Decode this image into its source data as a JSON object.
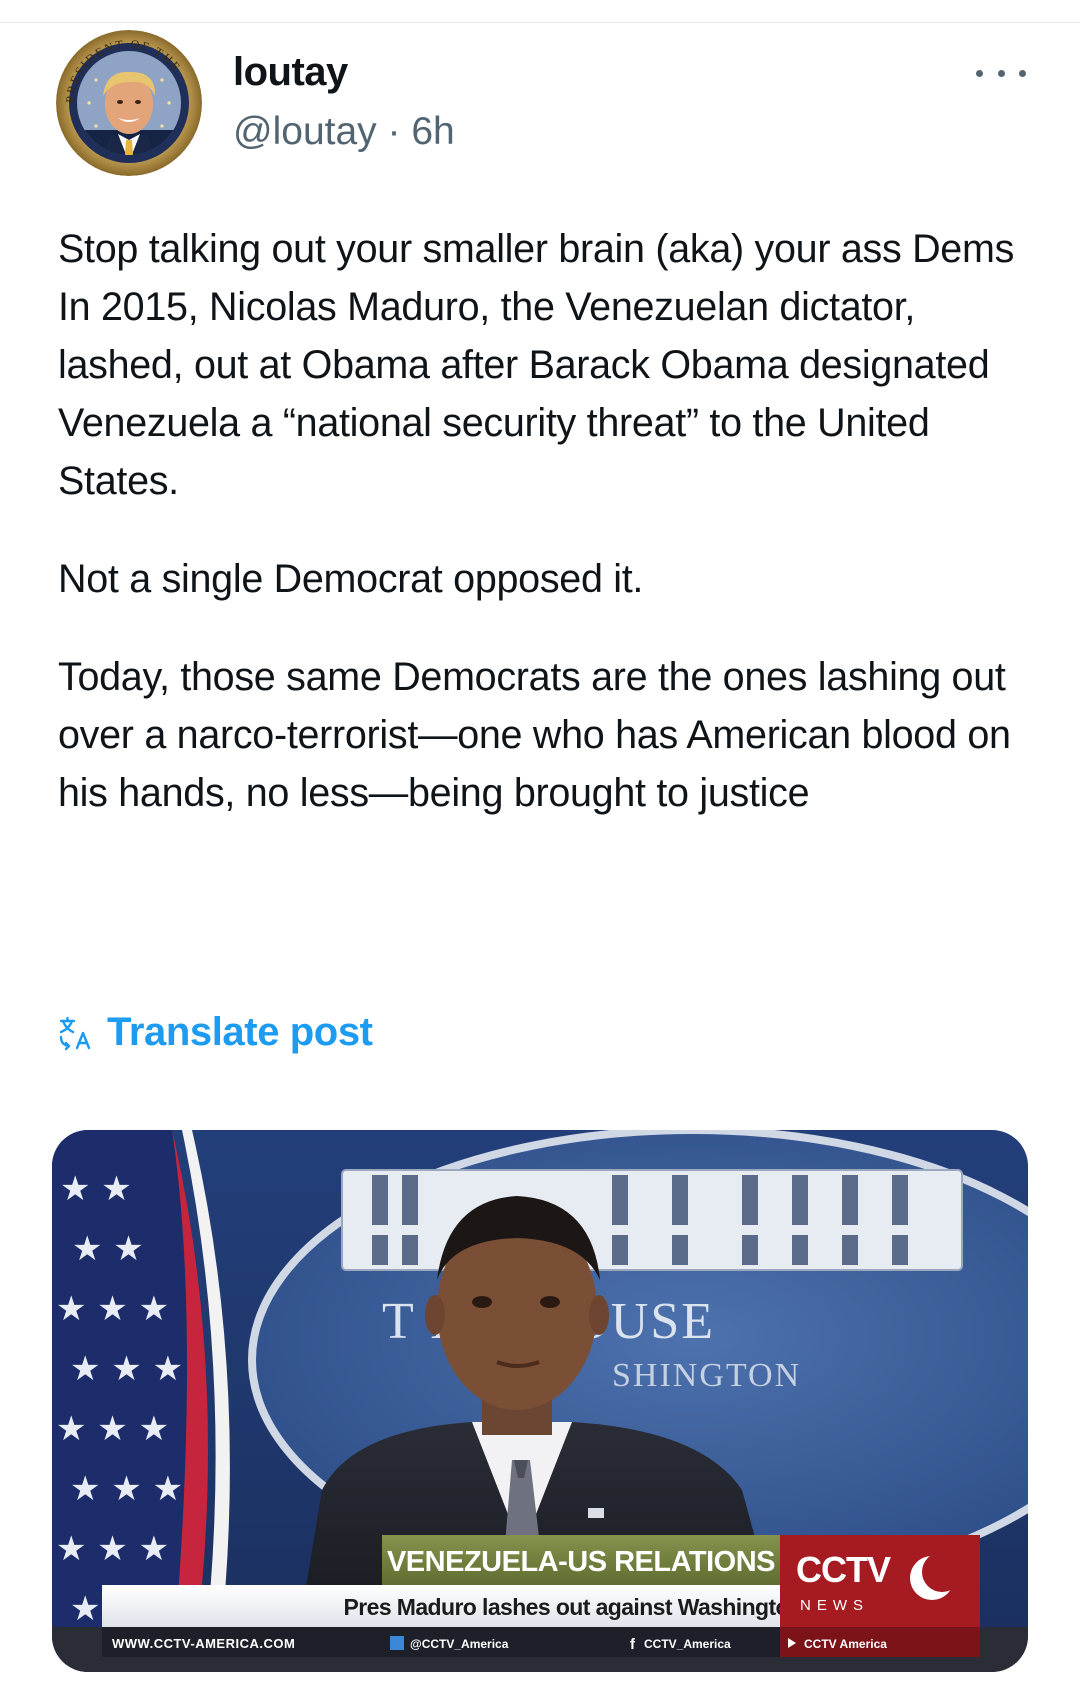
{
  "post": {
    "author": {
      "display_name": "loutay",
      "handle": "@loutay",
      "separator": "·",
      "time": "6h",
      "avatar_seal_text": "PRESIDENT OF THE"
    },
    "more_icon": "ellipsis-icon",
    "body": {
      "line_1": "Stop talking out your smaller brain (aka) your ass Dems",
      "line_2": "In 2015, Nicolas Maduro, the Venezuelan dictator, lashed, out at Obama after Barack Obama designated Venezuela a “national security threat” to the United States.",
      "line_3": "Not a single Democrat opposed it.",
      "line_4": "Today, those same Democrats are the ones lashing out over a narco-terrorist—one who has American blood on his hands, no less—being brought to justice"
    },
    "translate": {
      "icon": "translate-icon",
      "label": "Translate post"
    },
    "media": {
      "sign_line_1": "T    ITE HOUSE",
      "sign_line_2": "SHINGTON",
      "ticker_headline": "VENEZUELA-US RELATIONS",
      "ticker_subline": "Pres Maduro lashes out against Washington",
      "website": "WWW.CCTV-AMERICA.COM",
      "twitter_handle": "@CCTV_America",
      "facebook_handle": "CCTV_America",
      "youtube_channel": "CCTV America",
      "logo_text": "CCTV",
      "logo_subtext": "NEWS"
    }
  },
  "colors": {
    "link_blue": "#1d9bf0",
    "text_primary": "#0f1419",
    "text_secondary": "#536471",
    "ticker_green": "#6f7f3e",
    "cctv_red": "#b3141c"
  }
}
